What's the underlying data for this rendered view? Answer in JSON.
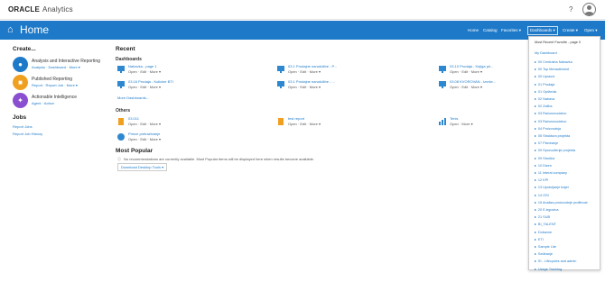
{
  "topbar": {
    "brand": "ORACLE",
    "product": "Analytics",
    "help": "?"
  },
  "header": {
    "title": "Home",
    "nav": [
      "Home",
      "Catalog",
      "Favorites ▾",
      "Dashboards ▾",
      "Create ▾",
      "Open ▾"
    ]
  },
  "create": {
    "heading": "Create...",
    "items": [
      {
        "title": "Analysis and Interactive Reporting",
        "links": "Analysis · Dashboard · More ▾",
        "color": "#1e7ac9"
      },
      {
        "title": "Published Reporting",
        "links": "Report · Report Job · More ▾",
        "color": "#f0a020"
      },
      {
        "title": "Actionable Intelligence",
        "links": "Agent · Action",
        "color": "#8a4fd0"
      }
    ]
  },
  "jobs": {
    "heading": "Jobs",
    "links": [
      "Report Jobs",
      "Report Job History"
    ]
  },
  "recent": {
    "heading": "Recent",
    "dashboards_label": "Dashboards",
    "dashboards": [
      {
        "name": "Nabavka - page 1",
        "acts": "Open · Edit · More ▾"
      },
      {
        "name": "03.1 Prodajne naruddžbe - P...",
        "acts": "Open · Edit · More ▾"
      },
      {
        "name": "03.10 Prodaja - Knjiga pri...",
        "acts": "Open · Edit · More ▾"
      },
      {
        "name": "03.16 Prodaja - Kolicine BTI",
        "acts": "Open · Edit · More ▾"
      },
      {
        "name": "03.1 Prodajne naruddžbe - ...",
        "acts": "Open · Edit · More ▾"
      },
      {
        "name": "03.08 KVOROVAN - Izvrše...",
        "acts": "Open · Edit · More ▾"
      }
    ],
    "more_dashboards": "More Dashboards...",
    "others_label": "Others",
    "others": [
      {
        "name": "03.011",
        "acts": "Open · Edit · More ▾",
        "icon": "report"
      },
      {
        "name": "test report",
        "acts": "Open · Edit · More ▾",
        "icon": "report"
      },
      {
        "name": "Tenis",
        "acts": "Open · More ▾",
        "icon": "chart"
      },
      {
        "name": "Prince pretraživanje",
        "acts": "Open · Edit · More ▾",
        "icon": "dash"
      }
    ]
  },
  "popular": {
    "heading": "Most Popular",
    "message": "No recommendations are currently available. Most Popular items will be displayed here when results become available.",
    "button": "Download Desktop Tools ▾"
  },
  "dropdown": {
    "top": [
      "Most Recent Favorite - page 0",
      "My Dashboard"
    ],
    "items": [
      "00 Centralna Nabavka",
      "00 Top Menadžment",
      "00 Upravni",
      "01 Prodaja",
      "01 Opšte/ak",
      "02 Nabava",
      "02 Zaliha",
      "03 Računovodstvo",
      "03 Računovodstvo",
      "04 Proizvodnja",
      "05 Struktura projekta",
      "07 Planiranje",
      "09 Sprovođenje projekta",
      "09 Struška",
      "10 Dizen",
      "11 Interal company",
      "12 KPI",
      "13 Upravljanje trajet",
      "14 OSI",
      "15 Analiza proizvodnje profitnost",
      "20 E-trgovina",
      "21 SUB",
      "BI_TALENT",
      "Dobavne",
      "ETI",
      "Sample Lite",
      "Sediranje",
      "SI - Lifecycles and admin",
      "Usage Tracking"
    ]
  }
}
